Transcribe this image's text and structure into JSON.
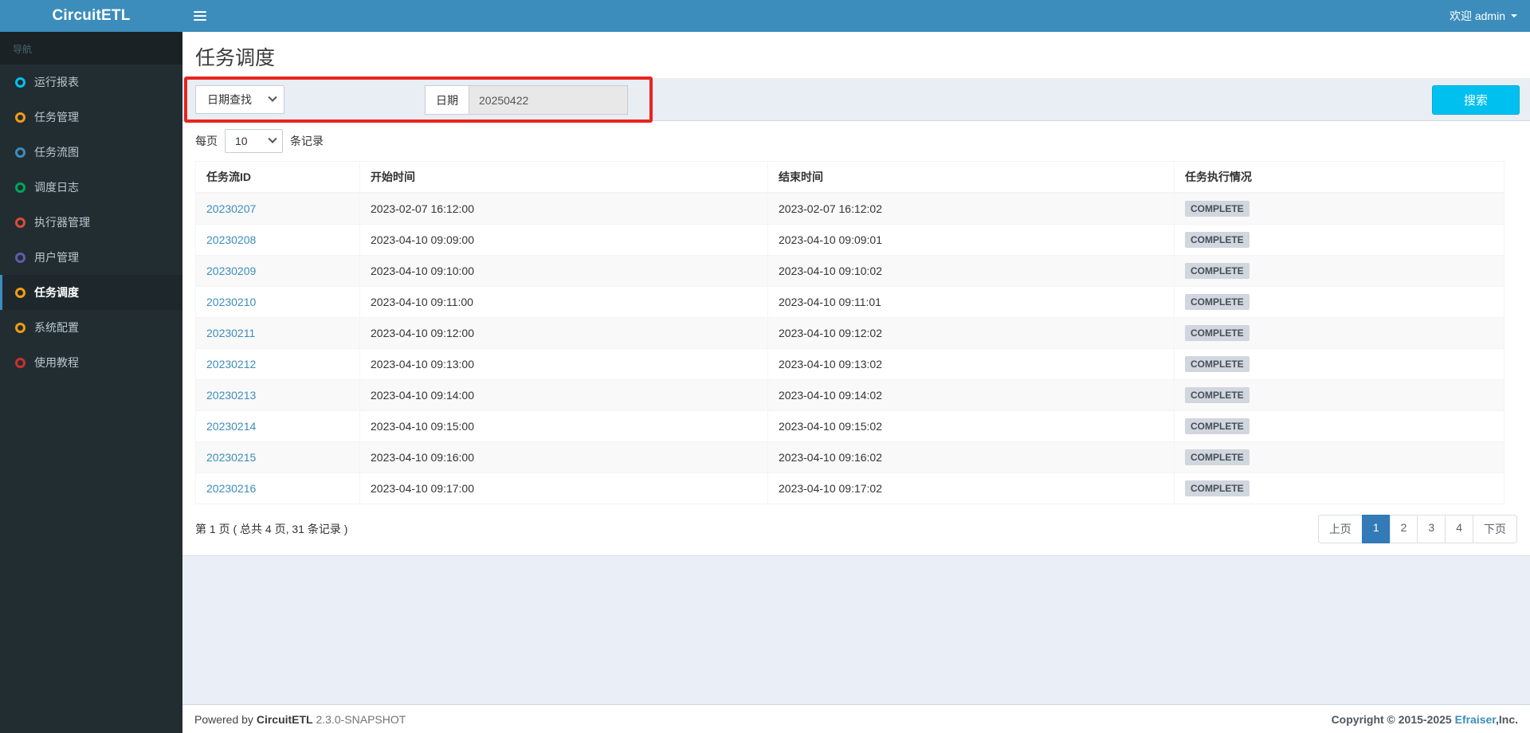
{
  "topbar": {
    "logo": "CircuitETL",
    "welcome": "欢迎 admin"
  },
  "sidebar": {
    "header": "导航",
    "items": [
      {
        "label": "运行报表",
        "icon_color": "#00c0ef",
        "active": false
      },
      {
        "label": "任务管理",
        "icon_color": "#f39c12",
        "active": false
      },
      {
        "label": "任务流图",
        "icon_color": "#3c8dbc",
        "active": false
      },
      {
        "label": "调度日志",
        "icon_color": "#00a65a",
        "active": false
      },
      {
        "label": "执行器管理",
        "icon_color": "#dd4b39",
        "active": false
      },
      {
        "label": "用户管理",
        "icon_color": "#605ca8",
        "active": false
      },
      {
        "label": "任务调度",
        "icon_color": "#f39c12",
        "active": true
      },
      {
        "label": "系统配置",
        "icon_color": "#f39c12",
        "active": false
      },
      {
        "label": "使用教程",
        "icon_color": "#c9302c",
        "active": false
      }
    ]
  },
  "page": {
    "title": "任务调度"
  },
  "search": {
    "type_selected": "日期查找",
    "date_label": "日期",
    "date_value": "20250422",
    "button_label": "搜索",
    "annotation_color": "#e8251f"
  },
  "per_page": {
    "prefix": "每页",
    "selected": "10",
    "suffix": "条记录"
  },
  "table": {
    "headers": [
      "任务流ID",
      "开始时间",
      "结束时间",
      "任务执行情况"
    ],
    "rows": [
      {
        "id": "20230207",
        "start": "2023-02-07 16:12:00",
        "end": "2023-02-07 16:12:02",
        "status": "COMPLETE"
      },
      {
        "id": "20230208",
        "start": "2023-04-10 09:09:00",
        "end": "2023-04-10 09:09:01",
        "status": "COMPLETE"
      },
      {
        "id": "20230209",
        "start": "2023-04-10 09:10:00",
        "end": "2023-04-10 09:10:02",
        "status": "COMPLETE"
      },
      {
        "id": "20230210",
        "start": "2023-04-10 09:11:00",
        "end": "2023-04-10 09:11:01",
        "status": "COMPLETE"
      },
      {
        "id": "20230211",
        "start": "2023-04-10 09:12:00",
        "end": "2023-04-10 09:12:02",
        "status": "COMPLETE"
      },
      {
        "id": "20230212",
        "start": "2023-04-10 09:13:00",
        "end": "2023-04-10 09:13:02",
        "status": "COMPLETE"
      },
      {
        "id": "20230213",
        "start": "2023-04-10 09:14:00",
        "end": "2023-04-10 09:14:02",
        "status": "COMPLETE"
      },
      {
        "id": "20230214",
        "start": "2023-04-10 09:15:00",
        "end": "2023-04-10 09:15:02",
        "status": "COMPLETE"
      },
      {
        "id": "20230215",
        "start": "2023-04-10 09:16:00",
        "end": "2023-04-10 09:16:02",
        "status": "COMPLETE"
      },
      {
        "id": "20230216",
        "start": "2023-04-10 09:17:00",
        "end": "2023-04-10 09:17:02",
        "status": "COMPLETE"
      }
    ]
  },
  "pagination": {
    "info": "第 1 页 ( 总共 4 页,  31 条记录 )",
    "prev_label": "上页",
    "next_label": "下页",
    "pages": [
      "1",
      "2",
      "3",
      "4"
    ],
    "active_page": "1"
  },
  "footer": {
    "powered_prefix": "Powered by",
    "brand": "CircuitETL",
    "version": "2.3.0-SNAPSHOT",
    "copyright": "Copyright © 2015-2025",
    "company": "Efraiser",
    "company_suffix": ",Inc."
  }
}
